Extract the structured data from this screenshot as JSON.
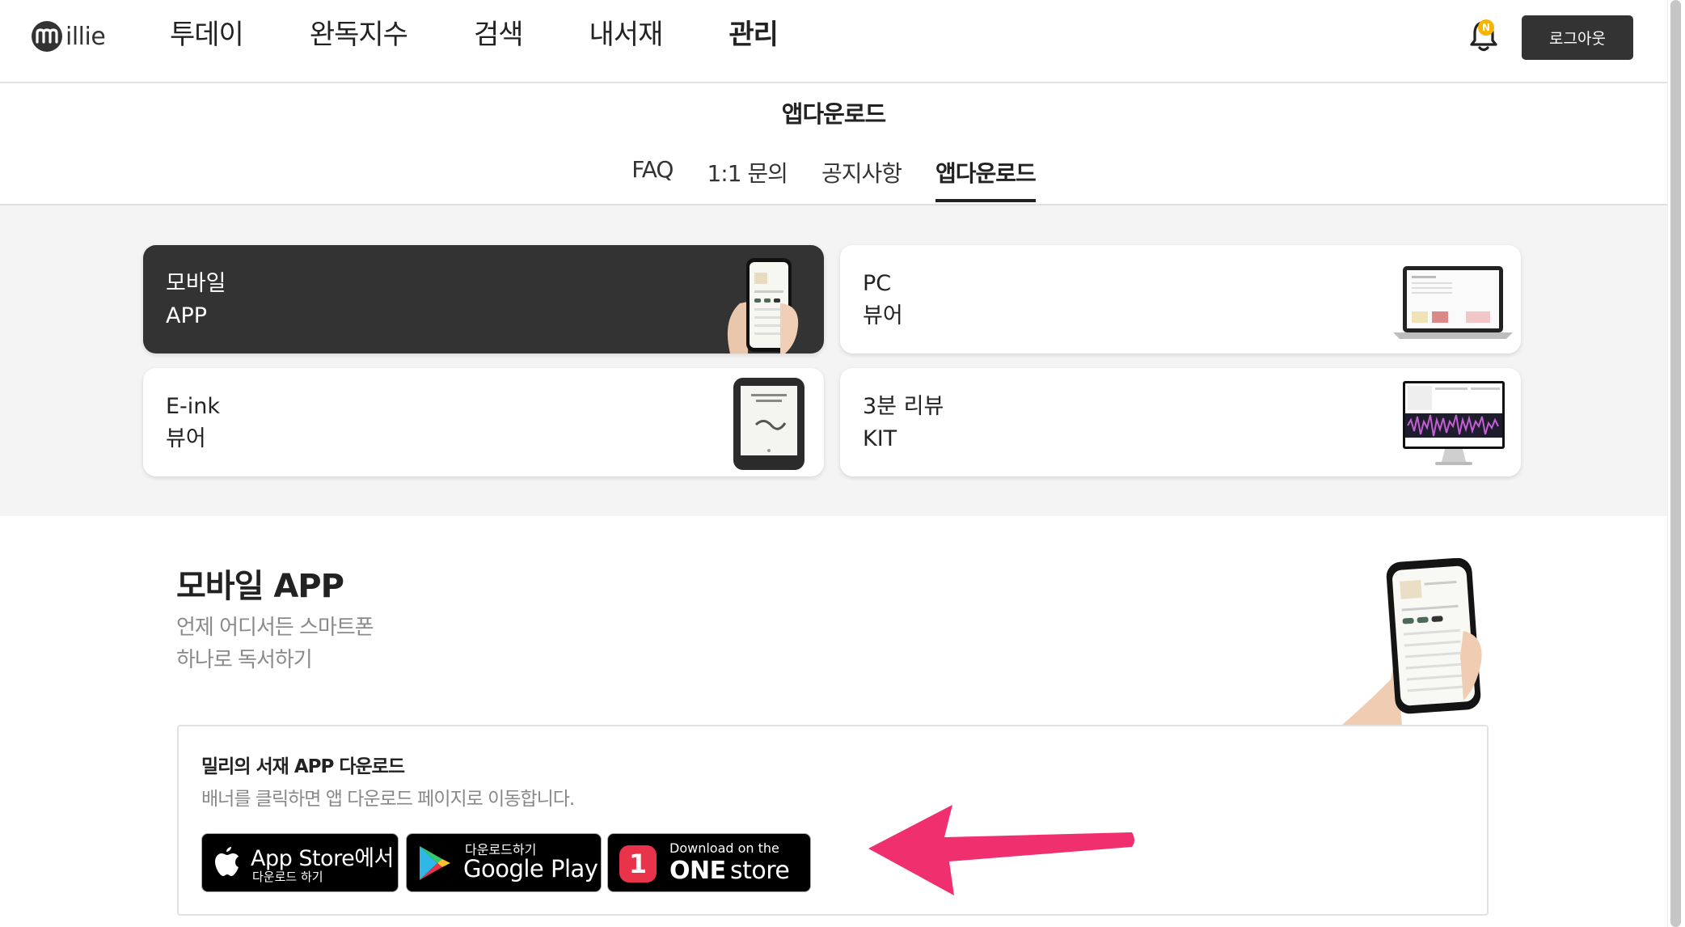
{
  "brand": {
    "logo_text": "illie"
  },
  "nav": {
    "items": [
      {
        "label": "투데이",
        "active": false
      },
      {
        "label": "완독지수",
        "active": false
      },
      {
        "label": "검색",
        "active": false
      },
      {
        "label": "내서재",
        "active": false
      },
      {
        "label": "관리",
        "active": true
      }
    ]
  },
  "header": {
    "bell_icon": "bell-icon",
    "notification_badge": "N",
    "logout_label": "로그아웃"
  },
  "page": {
    "title": "앱다운로드",
    "tabs": [
      {
        "label": "FAQ",
        "active": false
      },
      {
        "label": "1:1 문의",
        "active": false
      },
      {
        "label": "공지사항",
        "active": false
      },
      {
        "label": "앱다운로드",
        "active": true
      }
    ]
  },
  "cards": [
    {
      "line1": "모바일",
      "line2": "APP",
      "selected": true
    },
    {
      "line1": "PC",
      "line2": "뷰어",
      "selected": false
    },
    {
      "line1": "E-ink",
      "line2": "뷰어",
      "selected": false
    },
    {
      "line1": "3분 리뷰",
      "line2": "KIT",
      "selected": false
    }
  ],
  "section": {
    "title": "모바일 APP",
    "desc_line1": "언제 어디서든 스마트폰",
    "desc_line2": "하나로 독서하기"
  },
  "download": {
    "title": "밀리의 서재 APP 다운로드",
    "subtitle": "배너를 클릭하면 앱 다운로드 페이지로 이동합니다.",
    "app_store": {
      "line1": "App Store에서",
      "line2": "다운로드 하기"
    },
    "google_play": {
      "line1": "다운로드하기",
      "line2": "Google Play"
    },
    "one_store": {
      "line1": "Download on the",
      "line2_bold": "ONE",
      "line2_rest": "store",
      "badge": "1"
    }
  },
  "colors": {
    "dark": "#333333",
    "card_bg": "#f4f4f4",
    "accent_arrow": "#f0306e",
    "badge": "#f7b500",
    "onestore": "#e8334a"
  }
}
